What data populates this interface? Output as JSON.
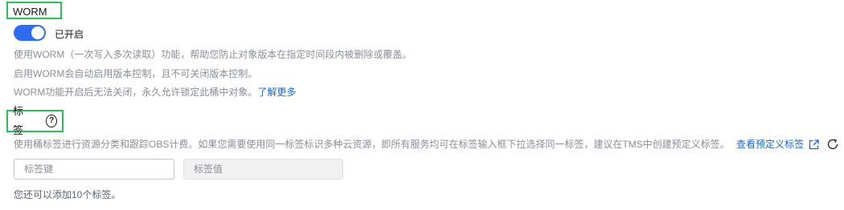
{
  "worm": {
    "title": "WORM",
    "toggle_label": "已开启",
    "toggle_on": true,
    "desc_1": "使用WORM（一次写入多次读取）功能，帮助您防止对象版本在指定时间段内被删除或覆盖。",
    "desc_2": "启用WORM会自动启用版本控制，且不可关闭版本控制。",
    "desc_3": "WORM功能开启后无法关闭，永久允许锁定此桶中对象。",
    "learn_more": "了解更多"
  },
  "tags": {
    "title": "标签",
    "help_icon": "question-circle-icon",
    "desc": "使用桶标签进行资源分类和跟踪OBS计费。如果您需要使用同一标签标识多种云资源，即所有服务均可在标签输入框下拉选择同一标签，建议在TMS中创建预定义标签。",
    "view_predefined": "查看预定义标签",
    "external_icon": "external-link-icon",
    "refresh_icon": "refresh-icon",
    "key_placeholder": "标签键",
    "value_placeholder": "标签值",
    "key_value": "",
    "value_value": "",
    "remaining": "您还可以添加10个标签。"
  },
  "colors": {
    "accent": "#2e6cf0",
    "link": "#1a66d7",
    "highlight_border": "#2dbd5a",
    "muted_text": "#8a8e99"
  }
}
